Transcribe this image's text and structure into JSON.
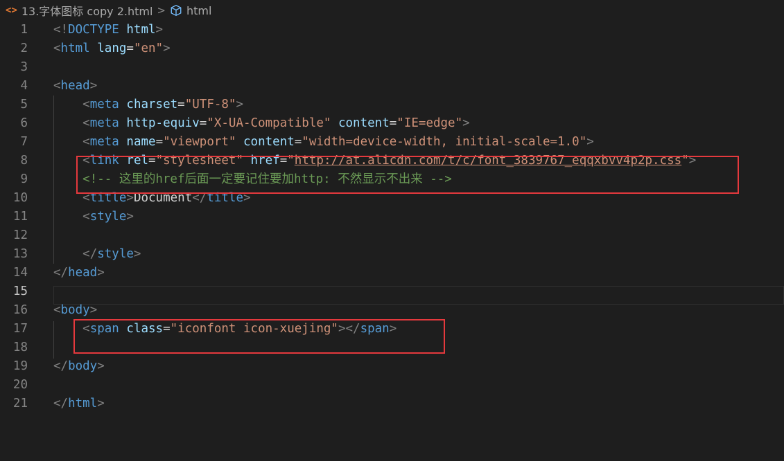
{
  "breadcrumb": {
    "file_icon": "<>",
    "file_name": "13.字体图标 copy 2.html",
    "separator": ">",
    "element_icon": "cube-icon",
    "element_name": "html"
  },
  "editor": {
    "active_line": 15,
    "lines": [
      {
        "n": "1",
        "tokens": [
          [
            "t",
            "<!"
          ],
          [
            "tn",
            "DOCTYPE"
          ],
          [
            "tx",
            " "
          ],
          [
            "an",
            "html"
          ],
          [
            "t",
            ">"
          ]
        ]
      },
      {
        "n": "2",
        "tokens": [
          [
            "t",
            "<"
          ],
          [
            "tn",
            "html"
          ],
          [
            "tx",
            " "
          ],
          [
            "an",
            "lang"
          ],
          [
            "eq",
            "="
          ],
          [
            "av",
            "\"en\""
          ],
          [
            "t",
            ">"
          ]
        ]
      },
      {
        "n": "3",
        "tokens": []
      },
      {
        "n": "4",
        "tokens": [
          [
            "t",
            "<"
          ],
          [
            "tn",
            "head"
          ],
          [
            "t",
            ">"
          ]
        ]
      },
      {
        "n": "5",
        "tokens": [
          [
            "tx",
            "    "
          ],
          [
            "t",
            "<"
          ],
          [
            "tn",
            "meta"
          ],
          [
            "tx",
            " "
          ],
          [
            "an",
            "charset"
          ],
          [
            "eq",
            "="
          ],
          [
            "av",
            "\"UTF-8\""
          ],
          [
            "t",
            ">"
          ]
        ]
      },
      {
        "n": "6",
        "tokens": [
          [
            "tx",
            "    "
          ],
          [
            "t",
            "<"
          ],
          [
            "tn",
            "meta"
          ],
          [
            "tx",
            " "
          ],
          [
            "an",
            "http-equiv"
          ],
          [
            "eq",
            "="
          ],
          [
            "av",
            "\"X-UA-Compatible\""
          ],
          [
            "tx",
            " "
          ],
          [
            "an",
            "content"
          ],
          [
            "eq",
            "="
          ],
          [
            "av",
            "\"IE=edge\""
          ],
          [
            "t",
            ">"
          ]
        ]
      },
      {
        "n": "7",
        "tokens": [
          [
            "tx",
            "    "
          ],
          [
            "t",
            "<"
          ],
          [
            "tn",
            "meta"
          ],
          [
            "tx",
            " "
          ],
          [
            "an",
            "name"
          ],
          [
            "eq",
            "="
          ],
          [
            "av",
            "\"viewport\""
          ],
          [
            "tx",
            " "
          ],
          [
            "an",
            "content"
          ],
          [
            "eq",
            "="
          ],
          [
            "av",
            "\"width=device-width, initial-scale=1.0\""
          ],
          [
            "t",
            ">"
          ]
        ]
      },
      {
        "n": "8",
        "tokens": [
          [
            "tx",
            "    "
          ],
          [
            "t",
            "<"
          ],
          [
            "tn",
            "link"
          ],
          [
            "tx",
            " "
          ],
          [
            "an",
            "rel"
          ],
          [
            "eq",
            "="
          ],
          [
            "av",
            "\"stylesheet\""
          ],
          [
            "tx",
            " "
          ],
          [
            "an",
            "href"
          ],
          [
            "eq",
            "="
          ],
          [
            "av",
            "\""
          ],
          [
            "av url",
            "http://at.alicdn.com/t/c/font_3839767_eqqxbvv4p2p.css"
          ],
          [
            "av",
            "\""
          ],
          [
            "t",
            ">"
          ]
        ]
      },
      {
        "n": "9",
        "tokens": [
          [
            "tx",
            "    "
          ],
          [
            "cm",
            "<!-- 这里的href后面一定要记住要加http: 不然显示不出来 -->"
          ]
        ]
      },
      {
        "n": "10",
        "tokens": [
          [
            "tx",
            "    "
          ],
          [
            "t",
            "<"
          ],
          [
            "tn",
            "title"
          ],
          [
            "t",
            ">"
          ],
          [
            "tx",
            "Document"
          ],
          [
            "t",
            "</"
          ],
          [
            "tn",
            "title"
          ],
          [
            "t",
            ">"
          ]
        ]
      },
      {
        "n": "11",
        "tokens": [
          [
            "tx",
            "    "
          ],
          [
            "t",
            "<"
          ],
          [
            "tn",
            "style"
          ],
          [
            "t",
            ">"
          ]
        ]
      },
      {
        "n": "12",
        "tokens": []
      },
      {
        "n": "13",
        "tokens": [
          [
            "tx",
            "    "
          ],
          [
            "t",
            "</"
          ],
          [
            "tn",
            "style"
          ],
          [
            "t",
            ">"
          ]
        ]
      },
      {
        "n": "14",
        "tokens": [
          [
            "t",
            "</"
          ],
          [
            "tn",
            "head"
          ],
          [
            "t",
            ">"
          ]
        ]
      },
      {
        "n": "15",
        "tokens": []
      },
      {
        "n": "16",
        "tokens": [
          [
            "t",
            "<"
          ],
          [
            "tn",
            "body"
          ],
          [
            "t",
            ">"
          ]
        ]
      },
      {
        "n": "17",
        "tokens": [
          [
            "tx",
            "    "
          ],
          [
            "t",
            "<"
          ],
          [
            "tn",
            "span"
          ],
          [
            "tx",
            " "
          ],
          [
            "an",
            "class"
          ],
          [
            "eq",
            "="
          ],
          [
            "av",
            "\"iconfont icon-xuejing\""
          ],
          [
            "t",
            "></"
          ],
          [
            "tn",
            "span"
          ],
          [
            "t",
            ">"
          ]
        ]
      },
      {
        "n": "18",
        "tokens": []
      },
      {
        "n": "19",
        "tokens": [
          [
            "t",
            "</"
          ],
          [
            "tn",
            "body"
          ],
          [
            "t",
            ">"
          ]
        ]
      },
      {
        "n": "20",
        "tokens": []
      },
      {
        "n": "21",
        "tokens": [
          [
            "t",
            "</"
          ],
          [
            "tn",
            "html"
          ],
          [
            "t",
            ">"
          ]
        ]
      }
    ]
  },
  "colors": {
    "background": "#1e1e1e",
    "tag_name": "#569cd6",
    "attribute": "#9cdcfe",
    "string": "#ce9178",
    "comment": "#6a9955",
    "highlight_box": "#e5393d"
  }
}
